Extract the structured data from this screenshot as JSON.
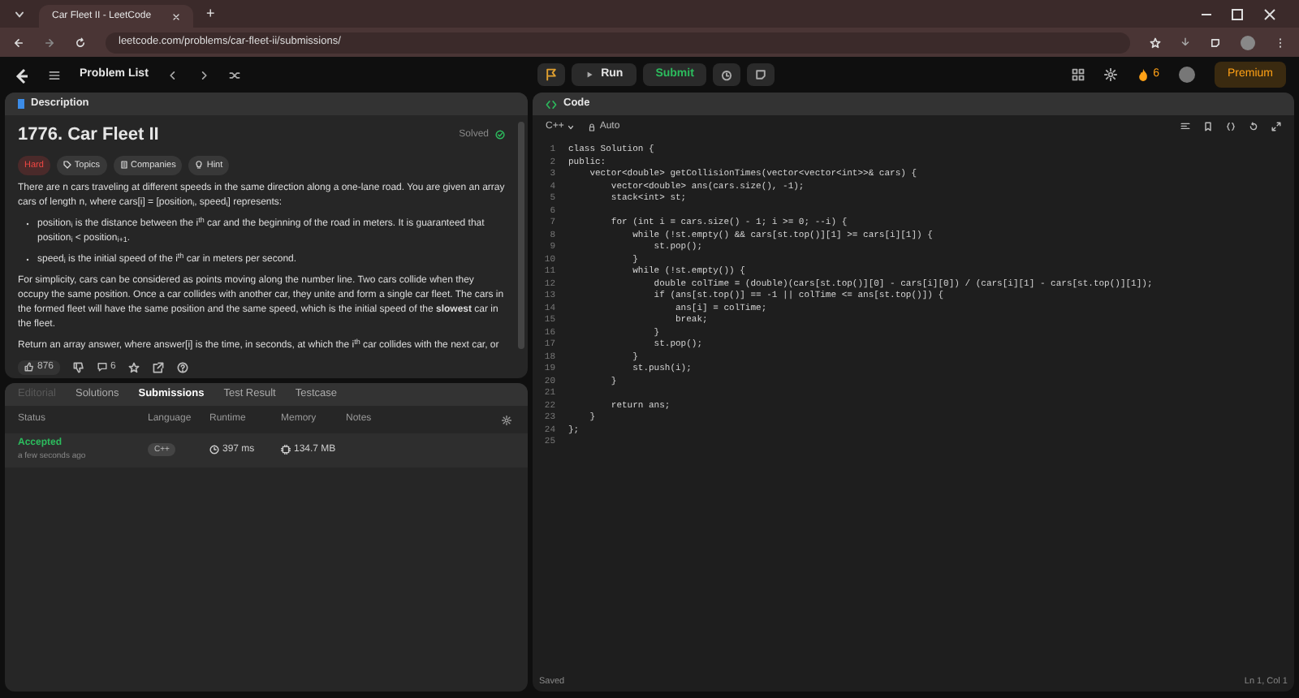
{
  "browser": {
    "tab_title": "Car Fleet II - LeetCode",
    "new_tab": "+",
    "url": "leetcode.com/problems/car-fleet-ii/submissions/"
  },
  "nav": {
    "problem_list": "Problem List",
    "run": "Run",
    "submit": "Submit",
    "streak": "6",
    "premium": "Premium"
  },
  "description": {
    "tab": "Description",
    "title": "1776. Car Fleet II",
    "status": "Solved",
    "tags": [
      {
        "label": "Hard",
        "kind": "difficulty"
      },
      {
        "label": "Topics",
        "kind": "topics"
      },
      {
        "label": "Companies",
        "kind": "companies"
      },
      {
        "label": "Hint",
        "kind": "hint"
      }
    ],
    "paragraphs": [
      {
        "kind": "text",
        "text": "There are n cars traveling at different speeds in the same direction along a one-lane road. You are given an array cars of length n, where cars[i] = [position$_{i}$, speed$_{i}$] represents:"
      },
      {
        "kind": "bullet",
        "text": "position$_{i}$ is the distance between the i$^{th}$ car and the beginning of the road in meters. It is guaranteed that position$_{i}$ < position$_{i+1}$."
      },
      {
        "kind": "bullet",
        "text": "speed$_{i}$ is the initial speed of the i$^{th}$ car in meters per second."
      },
      {
        "kind": "text",
        "text": "For simplicity, cars can be considered as points moving along the number line. Two cars collide when they occupy the same position. Once a car collides with another car, they unite and form a single car fleet. The cars in the formed fleet will have the same position and the same speed, which is the initial speed of the **slowest** car in the fleet."
      },
      {
        "kind": "text",
        "text": "Return an array answer, where answer[i] is the time, in seconds, at which the i$^{th}$ car collides with the next car, or"
      }
    ],
    "likes": "876",
    "comments": "6"
  },
  "results": {
    "tabs": [
      {
        "label": "Editorial",
        "selected": false,
        "disabled": true
      },
      {
        "label": "Solutions",
        "selected": false,
        "disabled": false
      },
      {
        "label": "Submissions",
        "selected": true,
        "disabled": false
      },
      {
        "label": "Test Result",
        "selected": false,
        "disabled": false
      },
      {
        "label": "Testcase",
        "selected": false,
        "disabled": false
      }
    ],
    "columns": [
      "Status",
      "Language",
      "Runtime",
      "Memory",
      "Notes"
    ],
    "rows": [
      {
        "status": "Accepted",
        "time": "a few seconds ago",
        "language": "C++",
        "runtime": "397 ms",
        "memory": "134.7 MB"
      }
    ]
  },
  "editor": {
    "tab": "Code",
    "language": "C++",
    "mode": "Auto",
    "status": "Saved",
    "cursor": "Ln 1, Col 1",
    "lines": [
      {
        "n": "1",
        "code": "class Solution {"
      },
      {
        "n": "2",
        "code": "public:"
      },
      {
        "n": "3",
        "code": "    vector<double> getCollisionTimes(vector<vector<int>>& cars) {"
      },
      {
        "n": "4",
        "code": "        vector<double> ans(cars.size(), -1);"
      },
      {
        "n": "5",
        "code": "        stack<int> st;"
      },
      {
        "n": "6"
      },
      {
        "n": "7",
        "code": "        for (int i = cars.size() - 1; i >= 0; --i) {"
      },
      {
        "n": "8",
        "code": "            while (!st.empty() && cars[st.top()][1] >= cars[i][1]) {"
      },
      {
        "n": "9",
        "code": "                st.pop();"
      },
      {
        "n": "10",
        "code": "            }"
      },
      {
        "n": "11",
        "code": "            while (!st.empty()) {"
      },
      {
        "n": "12",
        "code": "                double colTime = (double)(cars[st.top()][0] - cars[i][0]) / (cars[i][1] - cars[st.top()][1]);"
      },
      {
        "n": "13",
        "code": "                if (ans[st.top()] == -1 || colTime <= ans[st.top()]) {"
      },
      {
        "n": "14",
        "code": "                    ans[i] = colTime;"
      },
      {
        "n": "15",
        "code": "                    break;"
      },
      {
        "n": "16",
        "code": "                }"
      },
      {
        "n": "17",
        "code": "                st.pop();"
      },
      {
        "n": "18",
        "code": "            }"
      },
      {
        "n": "19",
        "code": "            st.push(i);"
      },
      {
        "n": "20",
        "code": "        }"
      },
      {
        "n": "21"
      },
      {
        "n": "22",
        "code": "        return ans;"
      },
      {
        "n": "23",
        "code": "    }"
      },
      {
        "n": "24",
        "code": "};"
      },
      {
        "n": "25"
      }
    ]
  }
}
